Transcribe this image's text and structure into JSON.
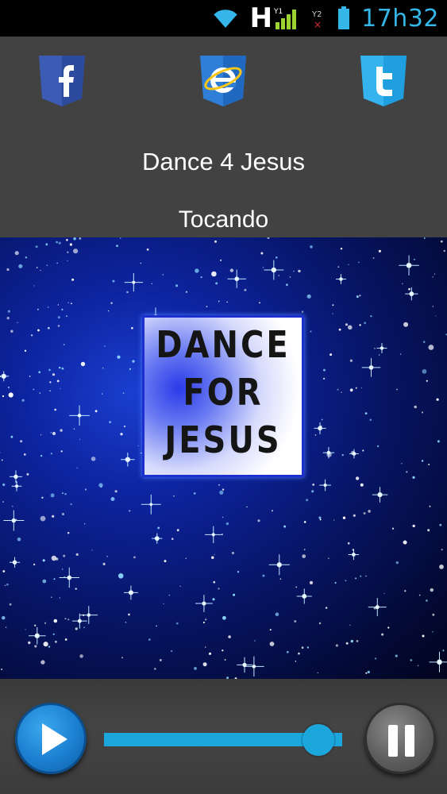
{
  "status_bar": {
    "network_type": "H",
    "time": "17h32",
    "icons": [
      "wifi-icon",
      "signal-strength-icon",
      "sim2-no-signal-icon",
      "battery-icon"
    ],
    "accent_color": "#35b6e8"
  },
  "social": {
    "facebook_icon": "facebook-icon",
    "website_icon": "internet-explorer-icon",
    "twitter_icon": "twitter-icon"
  },
  "station": {
    "name": "Dance 4 Jesus",
    "status": "Tocando"
  },
  "artwork": {
    "logo_lines": [
      "DANCE",
      "FOR",
      "JESUS"
    ]
  },
  "player": {
    "play_icon": "play-icon",
    "pause_icon": "pause-icon",
    "volume_level": 0.9,
    "accent_color": "#1ba6dc"
  }
}
